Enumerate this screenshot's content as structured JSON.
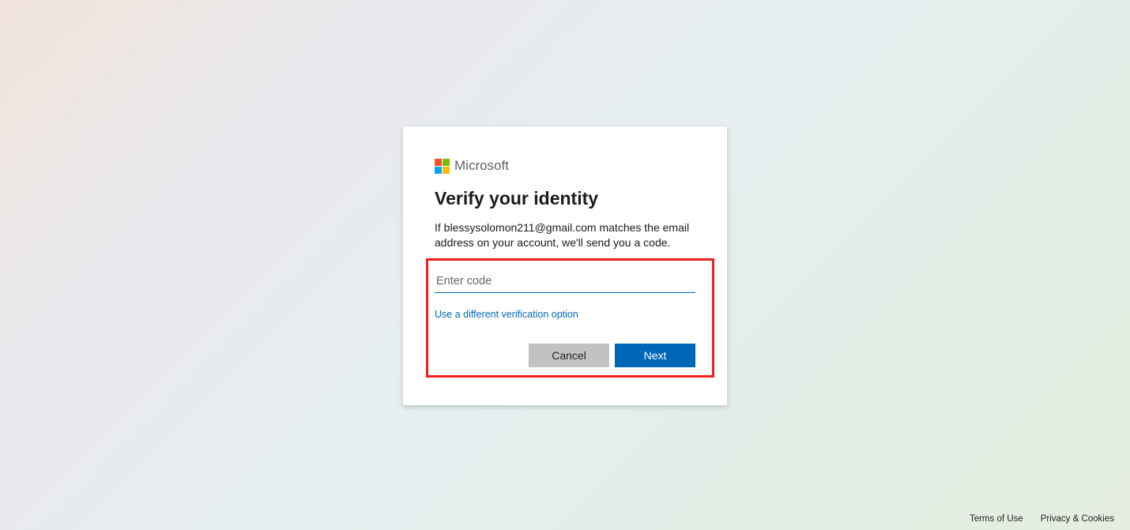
{
  "brand": {
    "name": "Microsoft"
  },
  "dialog": {
    "heading": "Verify your identity",
    "description": "If blessysolomon211@gmail.com matches the email address on your account, we'll send you a code.",
    "code_placeholder": "Enter code",
    "alt_option_link": "Use a different verification option",
    "cancel_label": "Cancel",
    "next_label": "Next"
  },
  "footer": {
    "terms": "Terms of Use",
    "privacy": "Privacy & Cookies"
  }
}
